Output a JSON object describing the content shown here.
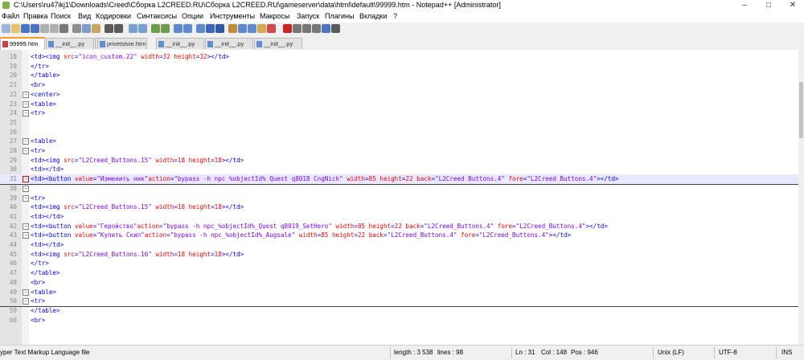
{
  "window": {
    "title": "C:\\Users\\ru47ikj1\\Downloads\\Creed\\Сборка L2CREED.RU\\Сборка L2CREED.RU\\gameserver\\data\\html\\default\\99999.htm - Notepad++ [Administrator]",
    "controls": [
      "–",
      "□",
      "✕"
    ]
  },
  "menu": {
    "items": [
      "Файл",
      "Правка",
      "Поиск",
      "Вид",
      "Кодировки",
      "Синтаксисы",
      "Опции",
      "Инструменты",
      "Макросы",
      "Запуск",
      "Плагины",
      "Вкладки",
      "?"
    ]
  },
  "toolbar": {
    "buttons": [
      {
        "name": "new-file-icon",
        "color": "#9ab7d9"
      },
      {
        "name": "open-file-icon",
        "color": "#e8c26a"
      },
      {
        "name": "save-icon",
        "color": "#4a74c4"
      },
      {
        "name": "save-all-icon",
        "color": "#4a74c4"
      },
      {
        "name": "close-icon",
        "color": "#b0b0b0"
      },
      {
        "name": "close-all-icon",
        "color": "#b0b0b0"
      },
      {
        "name": "print-icon",
        "color": "#777777"
      },
      {
        "name": "cut-icon",
        "color": "#8f8f8f"
      },
      {
        "name": "copy-icon",
        "color": "#7d9ccf"
      },
      {
        "name": "paste-icon",
        "color": "#c9a560"
      },
      {
        "name": "undo-icon",
        "color": "#5b5b5b"
      },
      {
        "name": "redo-icon",
        "color": "#5b5b5b"
      },
      {
        "name": "find-icon",
        "color": "#7aa0d0"
      },
      {
        "name": "replace-icon",
        "color": "#7aa0d0"
      },
      {
        "name": "zoom-in-icon",
        "color": "#6f9c4d"
      },
      {
        "name": "zoom-out-icon",
        "color": "#6f9c4d"
      },
      {
        "name": "sync-v-icon",
        "color": "#5e8bd0"
      },
      {
        "name": "sync-h-icon",
        "color": "#5e8bd0"
      },
      {
        "name": "word-wrap-icon",
        "color": "#5e8bd0"
      },
      {
        "name": "show-all-chars-icon",
        "color": "#3c66b5"
      },
      {
        "name": "indent-guide-icon",
        "color": "#2f5aa8"
      },
      {
        "name": "udl-icon",
        "color": "#c08b3a"
      },
      {
        "name": "doc-map-icon",
        "color": "#5e8bd0"
      },
      {
        "name": "function-list-icon",
        "color": "#5e8bd0"
      },
      {
        "name": "folder-workspace-icon",
        "color": "#d8a84a"
      },
      {
        "name": "monitoring-icon",
        "color": "#d04a4a"
      },
      {
        "name": "record-macro-icon",
        "color": "#cc2222"
      },
      {
        "name": "stop-macro-icon",
        "color": "#777777"
      },
      {
        "name": "play-macro-icon",
        "color": "#777777"
      },
      {
        "name": "play-multiple-icon",
        "color": "#777777"
      },
      {
        "name": "save-macro-icon",
        "color": "#4a74c4"
      },
      {
        "name": "run-icon",
        "color": "#5b5b5b"
      }
    ]
  },
  "tabs": [
    {
      "label": "99999.htm",
      "active": true
    },
    {
      "label": "__init__.py",
      "active": false
    },
    {
      "label": "__init__.py",
      "active": false
    },
    {
      "label": "privetstvie.htm",
      "active": false
    },
    {
      "label": "__init__.py",
      "active": false
    },
    {
      "label": "__init__.py",
      "active": false
    },
    {
      "label": "__init__.py",
      "active": false
    }
  ],
  "editor": {
    "current_line": "31",
    "lines": [
      {
        "n": "18",
        "fold": "line",
        "t": [
          [
            "<td><img ",
            "tag"
          ],
          [
            "src",
            "attr"
          ],
          [
            "=",
            "tag"
          ],
          [
            "\"icon_custom.22\"",
            "str"
          ],
          [
            " width",
            "attr"
          ],
          [
            "=",
            "tag"
          ],
          [
            "32",
            "attr"
          ],
          [
            " height",
            "attr"
          ],
          [
            "=",
            "tag"
          ],
          [
            "32",
            "attr"
          ],
          [
            "></td>",
            "tag"
          ]
        ]
      },
      {
        "n": "19",
        "fold": "line",
        "t": [
          [
            "</tr>",
            "tag"
          ]
        ]
      },
      {
        "n": "20",
        "fold": "end",
        "t": [
          [
            "</table>",
            "tag"
          ]
        ]
      },
      {
        "n": "21",
        "fold": "line",
        "t": [
          [
            "<br>",
            "tag"
          ]
        ]
      },
      {
        "n": "22",
        "fold": "box",
        "t": [
          [
            "<center>",
            "tag"
          ]
        ]
      },
      {
        "n": "23",
        "fold": "box",
        "t": [
          [
            "<table>",
            "tag"
          ]
        ]
      },
      {
        "n": "24",
        "fold": "box",
        "t": [
          [
            "<tr>",
            "tag"
          ]
        ]
      },
      {
        "n": "25",
        "fold": "line",
        "t": []
      },
      {
        "n": "26",
        "fold": "line",
        "t": []
      },
      {
        "n": "27",
        "fold": "box",
        "t": [
          [
            "<table>",
            "tag"
          ]
        ]
      },
      {
        "n": "28",
        "fold": "box",
        "t": [
          [
            "<tr>",
            "tag"
          ]
        ]
      },
      {
        "n": "29",
        "fold": "line",
        "t": [
          [
            "<td><img ",
            "tag"
          ],
          [
            "src",
            "attr"
          ],
          [
            "=",
            "tag"
          ],
          [
            "\"L2Creed_Buttons.15\"",
            "str"
          ],
          [
            " width",
            "attr"
          ],
          [
            "=",
            "tag"
          ],
          [
            "18",
            "attr"
          ],
          [
            " height",
            "attr"
          ],
          [
            "=",
            "tag"
          ],
          [
            "18",
            "attr"
          ],
          [
            "></td>",
            "tag"
          ]
        ]
      },
      {
        "n": "30",
        "fold": "line",
        "t": [
          [
            "<td></td>",
            "tag"
          ]
        ]
      },
      {
        "n": "31",
        "fold": "boxred",
        "t": [
          [
            "<td><button ",
            "tag"
          ],
          [
            "value",
            "attr"
          ],
          [
            "=",
            "tag"
          ],
          [
            "\"Изменить ник\"",
            "str"
          ],
          [
            "action",
            "attr"
          ],
          [
            "=",
            "tag"
          ],
          [
            "\"bypass -h npc %objectId% Quest q8018 CngNick\"",
            "str"
          ],
          [
            " width",
            "attr"
          ],
          [
            "=",
            "tag"
          ],
          [
            "85",
            "attr"
          ],
          [
            " height",
            "attr"
          ],
          [
            "=",
            "tag"
          ],
          [
            "22",
            "attr"
          ],
          [
            " back",
            "attr"
          ],
          [
            "=",
            "tag"
          ],
          [
            "\"L2Creed Buttons.4\"",
            "str"
          ],
          [
            " fore",
            "attr"
          ],
          [
            "=",
            "tag"
          ],
          [
            "\"L2Creed Buttons.4\"",
            "str"
          ],
          [
            "></td>",
            "tag"
          ]
        ]
      },
      {
        "n": "38",
        "fold": "box",
        "t": []
      },
      {
        "n": "39",
        "fold": "box",
        "t": [
          [
            "<tr>",
            "tag"
          ]
        ]
      },
      {
        "n": "40",
        "fold": "line",
        "t": [
          [
            "<td><img ",
            "tag"
          ],
          [
            "src",
            "attr"
          ],
          [
            "=",
            "tag"
          ],
          [
            "\"L2Creed_Buttons.15\"",
            "str"
          ],
          [
            " width",
            "attr"
          ],
          [
            "=",
            "tag"
          ],
          [
            "18",
            "attr"
          ],
          [
            " height",
            "attr"
          ],
          [
            "=",
            "tag"
          ],
          [
            "18",
            "attr"
          ],
          [
            "></td>",
            "tag"
          ]
        ]
      },
      {
        "n": "41",
        "fold": "line",
        "t": [
          [
            "<td></td>",
            "tag"
          ]
        ]
      },
      {
        "n": "42",
        "fold": "box",
        "t": [
          [
            "<td><button ",
            "tag"
          ],
          [
            "value",
            "attr"
          ],
          [
            "=",
            "tag"
          ],
          [
            "\"Геройство\"",
            "str"
          ],
          [
            "action",
            "attr"
          ],
          [
            "=",
            "tag"
          ],
          [
            "\"bypass -h npc_%objectId%_Quest q8019_SetHero\"",
            "str"
          ],
          [
            " width",
            "attr"
          ],
          [
            "=",
            "tag"
          ],
          [
            "85",
            "attr"
          ],
          [
            " height",
            "attr"
          ],
          [
            "=",
            "tag"
          ],
          [
            "22",
            "attr"
          ],
          [
            " back",
            "attr"
          ],
          [
            "=",
            "tag"
          ],
          [
            "\"L2Creed_Buttons.4\"",
            "str"
          ],
          [
            " fore",
            "attr"
          ],
          [
            "=",
            "tag"
          ],
          [
            "\"L2Creed_Buttons.4\"",
            "str"
          ],
          [
            "></td>",
            "tag"
          ]
        ]
      },
      {
        "n": "43",
        "fold": "box",
        "t": [
          [
            "<td><button ",
            "tag"
          ],
          [
            "value",
            "attr"
          ],
          [
            "=",
            "tag"
          ],
          [
            "\"Купить Скил\"",
            "str"
          ],
          [
            "action",
            "attr"
          ],
          [
            "=",
            "tag"
          ],
          [
            "\"bypass -h npc_%objectId%_Augsale\"",
            "str"
          ],
          [
            " width",
            "attr"
          ],
          [
            "=",
            "tag"
          ],
          [
            "85",
            "attr"
          ],
          [
            " height",
            "attr"
          ],
          [
            "=",
            "tag"
          ],
          [
            "22",
            "attr"
          ],
          [
            " back",
            "attr"
          ],
          [
            "=",
            "tag"
          ],
          [
            "\"L2Creed_Buttons.4\"",
            "str"
          ],
          [
            " fore",
            "attr"
          ],
          [
            "=",
            "tag"
          ],
          [
            "\"L2Creed_Buttons.4\"",
            "str"
          ],
          [
            "></td>",
            "tag"
          ]
        ]
      },
      {
        "n": "44",
        "fold": "line",
        "t": [
          [
            "<td></td>",
            "tag"
          ]
        ]
      },
      {
        "n": "45",
        "fold": "line",
        "t": [
          [
            "<td><img ",
            "tag"
          ],
          [
            "src",
            "attr"
          ],
          [
            "=",
            "tag"
          ],
          [
            "\"L2Creed_Buttons.16\"",
            "str"
          ],
          [
            " width",
            "attr"
          ],
          [
            "=",
            "tag"
          ],
          [
            "18",
            "attr"
          ],
          [
            " height",
            "attr"
          ],
          [
            "=",
            "tag"
          ],
          [
            "18",
            "attr"
          ],
          [
            "></td>",
            "tag"
          ]
        ]
      },
      {
        "n": "46",
        "fold": "line",
        "t": [
          [
            "</tr>",
            "tag"
          ]
        ]
      },
      {
        "n": "47",
        "fold": "end",
        "t": [
          [
            "</table>",
            "tag"
          ]
        ]
      },
      {
        "n": "48",
        "fold": "line",
        "t": [
          [
            "<br>",
            "tag"
          ]
        ]
      },
      {
        "n": "49",
        "fold": "box",
        "t": [
          [
            "<table>",
            "tag"
          ]
        ]
      },
      {
        "n": "50",
        "fold": "box",
        "t": [
          [
            "<tr>",
            "tag"
          ]
        ]
      },
      {
        "n": "59",
        "fold": "end",
        "t": [
          [
            "</table>",
            "tag"
          ]
        ]
      },
      {
        "n": "60",
        "fold": "line",
        "t": [
          [
            "<br>",
            "tag"
          ]
        ]
      }
    ]
  },
  "statusbar": {
    "file_type": "yper Text Markup Language file",
    "length": "length : 3 538",
    "lines": "lines : 98",
    "ln": "Ln : 31",
    "col": "Col : 148",
    "pos": "Pos : 946",
    "eol": "Unix (LF)",
    "encoding": "UTF-8",
    "mode": "INS"
  }
}
